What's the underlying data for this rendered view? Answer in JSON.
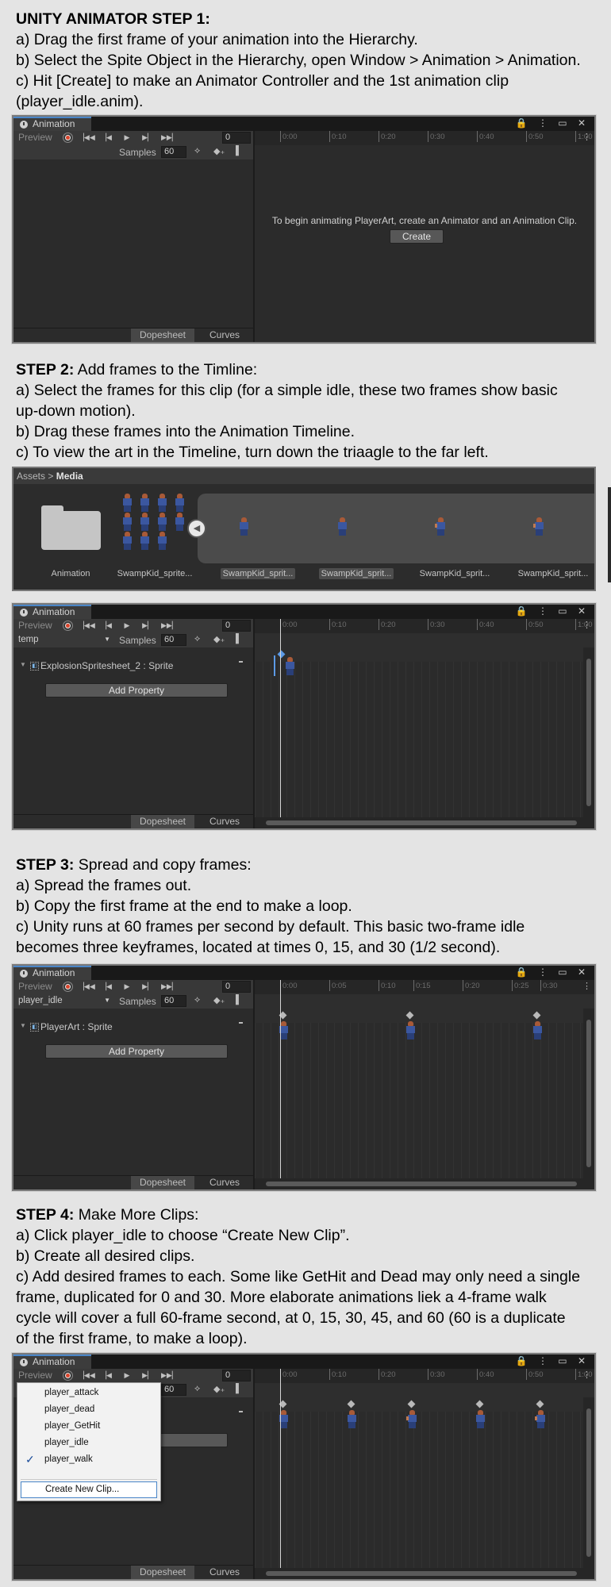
{
  "step1": {
    "title": "UNITY ANIMATOR STEP 1:",
    "lines": [
      "a) Drag the first frame of your animation into the Hierarchy.",
      "b) Select the Spite Object in the Hierarchy, open Window > Animation > Animation.",
      "c) Hit [Create] to make an Animator Controller and the 1st animation clip",
      "(player_idle.anim)."
    ]
  },
  "step2": {
    "title": "STEP 2:",
    "title_rest": " Add frames to the Timline:",
    "lines": [
      "a) Select the frames for this clip (for a simple idle, these two frames show basic",
      "up-down motion).",
      "b) Drag these frames into the Animation Timeline.",
      "c) To view the art in the Timeline, turn down the triaagle to the far left."
    ]
  },
  "step3": {
    "title": "STEP 3:",
    "title_rest": " Spread and copy frames:",
    "lines": [
      "a) Spread the frames out.",
      "b) Copy the first frame at the end to make a loop.",
      "c) Unity runs at 60 frames per second by default. This basic two-frame idle",
      "becomes three keyframes, located at times 0, 15, and 30 (1/2 second)."
    ]
  },
  "step4": {
    "title": "STEP 4:",
    "title_rest": " Make More Clips:",
    "lines": [
      "a) Click player_idle to choose “Create New Clip”.",
      "b) Create all desired clips.",
      "c) Add desired frames to each. Some like GetHit and Dead may only need a single",
      "frame, duplicated for 0 and 30. More elaborate animations liek a 4-frame walk",
      "cycle will cover a full 60-frame second, at 0, 15, 30, 45, and 60  (60 is a duplicate",
      "of the first frame, to make a loop)."
    ]
  },
  "common": {
    "tab_label": "Animation",
    "preview": "Preview",
    "frame": "0",
    "samples_label": "Samples",
    "samples_value": "60",
    "dopesheet": "Dopesheet",
    "curves": "Curves",
    "add_property": "Add Property",
    "window_controls": "⋮ ▭ ✕",
    "lock_icon": "lock-icon"
  },
  "panel1": {
    "ticks": [
      "0:00",
      "0:10",
      "0:20",
      "0:30",
      "0:40",
      "0:50",
      "1:00"
    ],
    "message": "To begin animating PlayerArt, create an Animator and an Animation Clip.",
    "create": "Create"
  },
  "assets": {
    "breadcrumb_root": "Assets",
    "breadcrumb_sep": ">",
    "breadcrumb_current": "Media",
    "items": [
      {
        "label": "Animation",
        "selected": false
      },
      {
        "label": "SwampKid_sprite...",
        "selected": false
      },
      {
        "label": "SwampKid_sprit...",
        "selected": true
      },
      {
        "label": "SwampKid_sprit...",
        "selected": true
      },
      {
        "label": "SwampKid_sprit...",
        "selected": false
      },
      {
        "label": "SwampKid_sprit...",
        "selected": false
      }
    ]
  },
  "panel2": {
    "clip": "temp",
    "ticks": [
      "0:00",
      "0:10",
      "0:20",
      "0:30",
      "0:40",
      "0:50",
      "1:00"
    ],
    "object": "ExplosionSpritesheet_2 : Sprite"
  },
  "panel3": {
    "clip": "player_idle",
    "ticks": [
      "0:00",
      "0:05",
      "0:10",
      "0:15",
      "0:20",
      "0:25",
      "0:30"
    ],
    "object": "PlayerArt : Sprite",
    "keyframes": [
      0,
      15,
      30
    ]
  },
  "panel4": {
    "clip": "player_walk",
    "ticks": [
      "0:00",
      "0:10",
      "0:20",
      "0:30",
      "0:40",
      "0:50",
      "1:00"
    ],
    "menu": [
      "player_attack",
      "player_dead",
      "player_GetHit",
      "player_idle",
      "player_walk"
    ],
    "checked": "player_walk",
    "create_new": "Create New Clip...",
    "keyframes": [
      0,
      15,
      30,
      45,
      60
    ]
  }
}
